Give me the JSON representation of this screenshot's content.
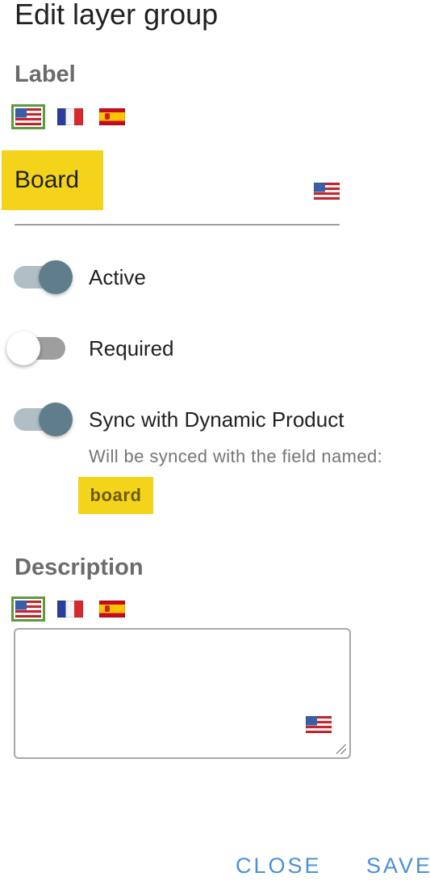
{
  "dialog": {
    "title": "Edit layer group",
    "label_section": {
      "heading": "Label",
      "flags": [
        "us-flag-icon",
        "fr-flag-icon",
        "es-flag-icon"
      ],
      "selected_flag": "us-flag-icon",
      "value": "Board"
    },
    "toggles": [
      {
        "name": "active",
        "label": "Active",
        "on": true
      },
      {
        "name": "required",
        "label": "Required",
        "on": false
      },
      {
        "name": "sync",
        "label": "Sync with Dynamic Product",
        "on": true
      }
    ],
    "sync_hint": "Will be synced with the field named:",
    "sync_field_name": "board",
    "description_section": {
      "heading": "Description",
      "flags": [
        "us-flag-icon",
        "fr-flag-icon",
        "es-flag-icon"
      ],
      "selected_flag": "us-flag-icon",
      "value": ""
    },
    "actions": {
      "close_label": "CLOSE",
      "save_label": "SAVE"
    }
  },
  "colors": {
    "highlight": "#f4d41a",
    "accent_button": "#4a90d9",
    "toggle_on_knob": "#607d8b",
    "toggle_on_track": "#b0bec5",
    "flag_selected_border": "#5d9a3b"
  }
}
